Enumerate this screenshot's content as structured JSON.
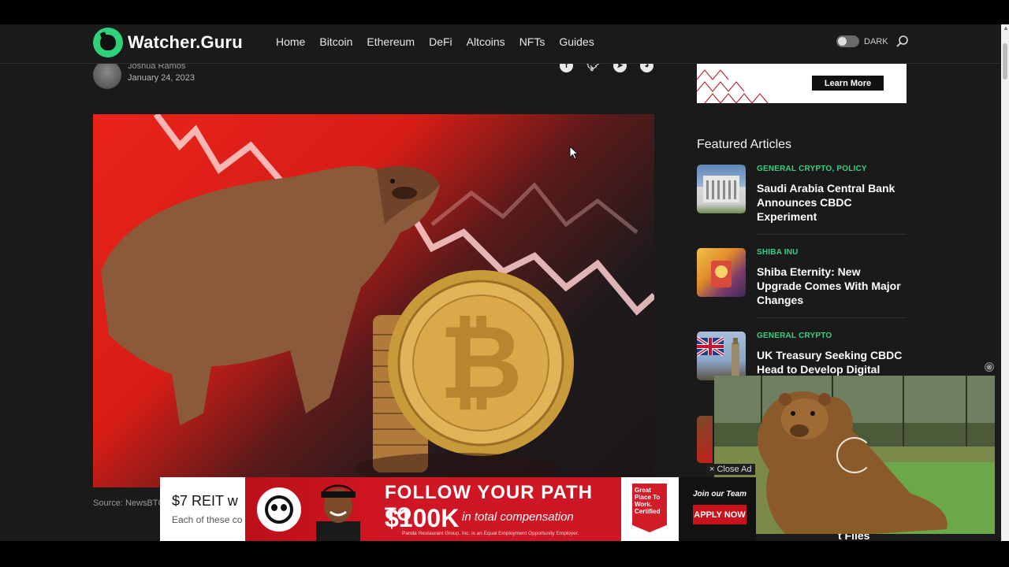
{
  "header": {
    "logo_text": "Watcher.Guru",
    "nav": [
      "Home",
      "Bitcoin",
      "Ethereum",
      "DeFi",
      "Altcoins",
      "NFTs",
      "Guides"
    ],
    "dark_label": "DARK"
  },
  "article": {
    "author_name": "Joshua Ramos",
    "date": "January 24, 2023",
    "share_icons": [
      "facebook-icon",
      "twitter-icon",
      "telegram-icon",
      "reddit-icon"
    ],
    "image_source": "Source: NewsBTC"
  },
  "sidebar": {
    "ad_button": "Learn More",
    "featured_title": "Featured Articles",
    "articles": [
      {
        "category": "GENERAL CRYPTO, POLICY",
        "headline": "Saudi Arabia Central Bank Announces CBDC Experiment"
      },
      {
        "category": "SHIBA INU",
        "headline": "Shiba Eternity: New Upgrade Comes With Major Changes"
      },
      {
        "category": "GENERAL CRYPTO",
        "headline": "UK Treasury Seeking CBDC Head to Develop Digital"
      }
    ],
    "partial_text": "t Files"
  },
  "bottom_ad": {
    "reit_title": "$7 REIT w",
    "reit_sub": "Each of these co",
    "headline": "FOLLOW YOUR PATH TO",
    "amount": "$100K",
    "comp": "in total compensation",
    "fine_print": "Panda Restaurant Group, Inc. is an Equal Employment Opportunity Employer.",
    "badge": "Great Place To Work. Certified",
    "join": "Join our Team",
    "apply": "APPLY NOW"
  },
  "video_ad": {
    "close_label": "× Close Ad",
    "close_x": "⊗"
  },
  "colors": {
    "accent_green": "#35d07f",
    "background": "#1a1a1a",
    "ad_red": "#cf1624"
  }
}
